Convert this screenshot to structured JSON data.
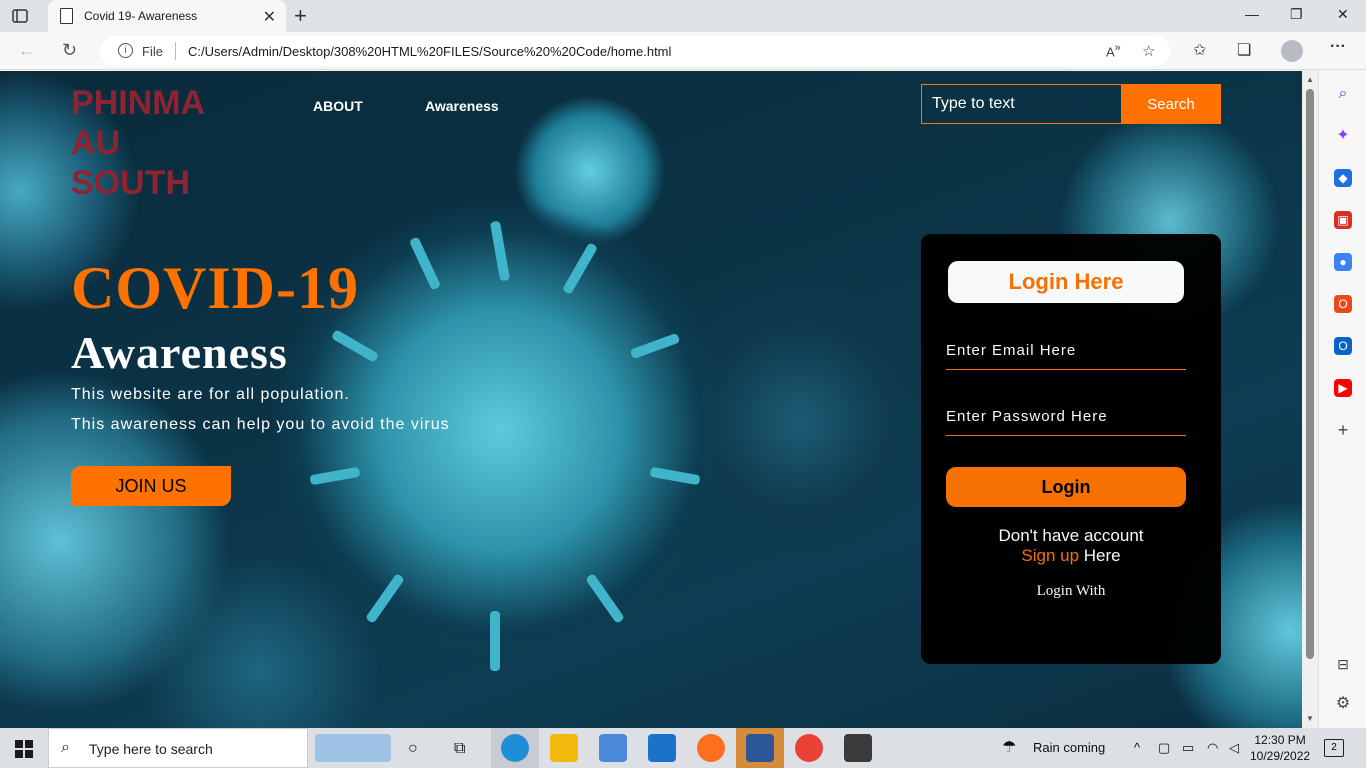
{
  "browser": {
    "tab_title": "Covid 19- Awareness",
    "tab_close": "✕",
    "new_tab": "+",
    "address_scheme_label": "File",
    "address_url": "C:/Users/Admin/Desktop/308%20HTML%20FILES/Source%20%20Code/home.html",
    "window_minimize": "—",
    "window_restore": "❐",
    "window_close": "✕"
  },
  "site": {
    "brand_line1": "PHINMA",
    "brand_line2": "AU",
    "brand_line3": "SOUTH",
    "nav": [
      "ABOUT",
      "Awareness"
    ],
    "search_placeholder": "Type to text",
    "search_button": "Search"
  },
  "hero": {
    "title": "COVID-19",
    "subtitle": "Awareness",
    "line1": "This website are for all population.",
    "line2": "This awareness can help you to avoid the virus",
    "join_button": "JOIN US"
  },
  "login": {
    "title": "Login Here",
    "email_placeholder": "Enter Email Here",
    "password_placeholder": "Enter Password Here",
    "button": "Login",
    "no_account": "Don't have account",
    "signup_link": "Sign up",
    "signup_suffix": " Here",
    "login_with": "Login With"
  },
  "taskbar": {
    "search_placeholder": "Type here to search",
    "weather": "Rain coming",
    "time": "12:30 PM",
    "date": "10/29/2022",
    "notifications": "2"
  },
  "colors": {
    "accent": "#ff7200",
    "brand": "#8e2431"
  }
}
